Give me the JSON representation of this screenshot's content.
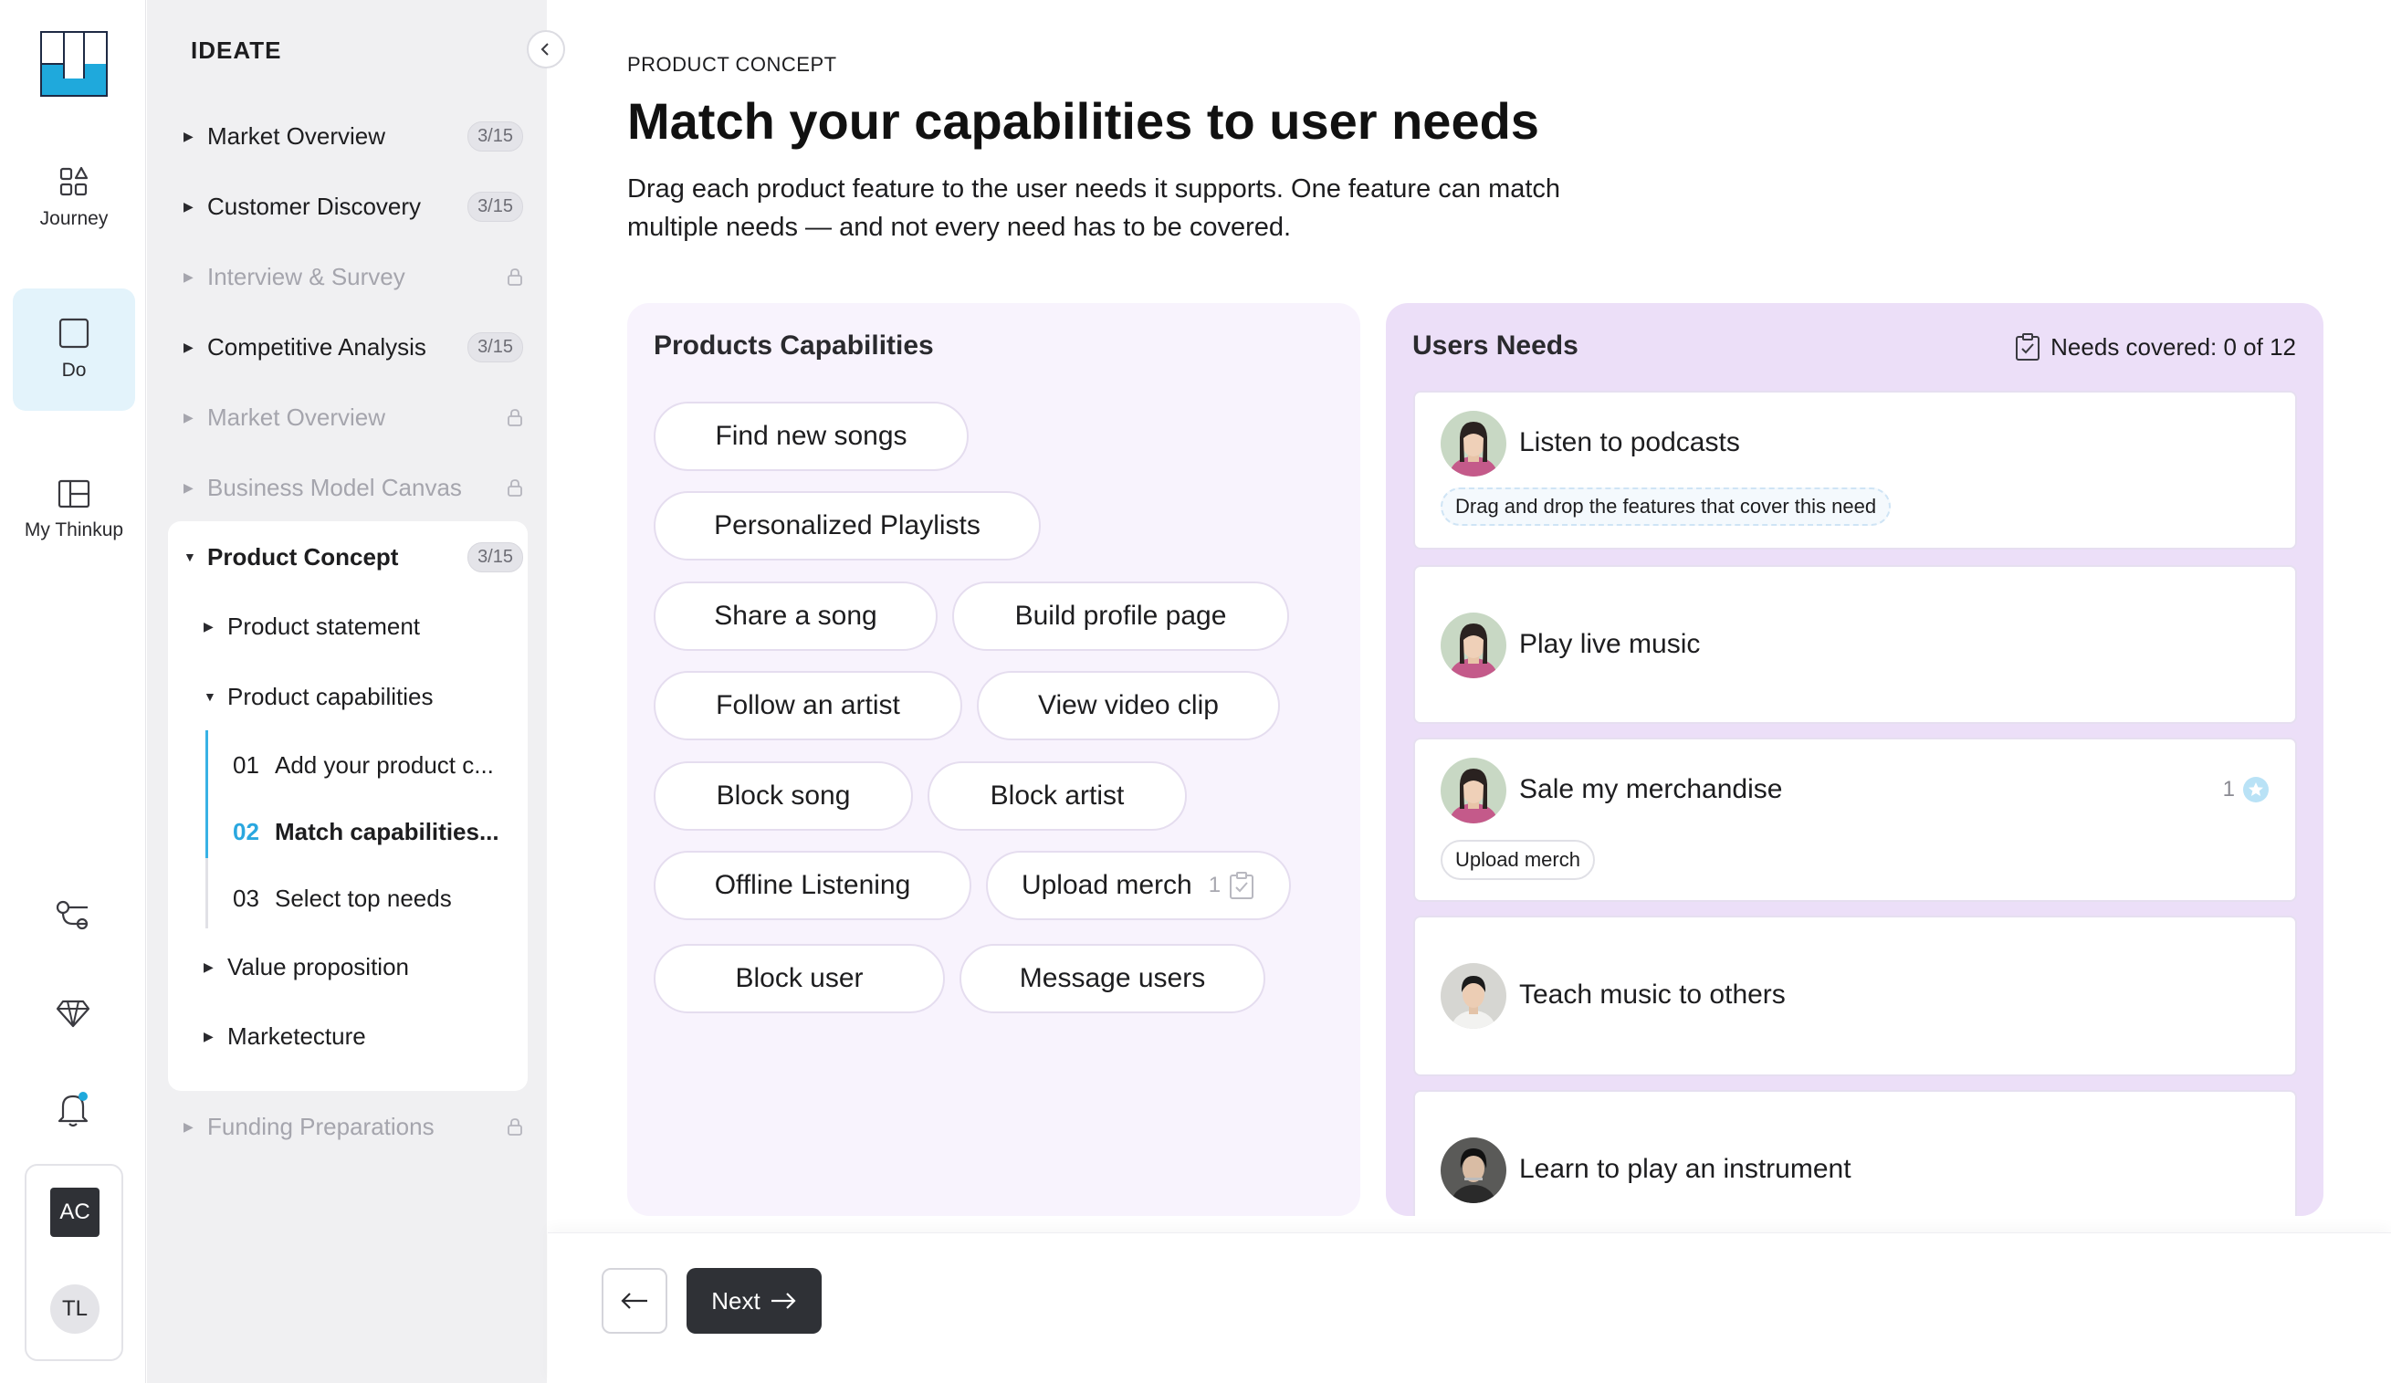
{
  "rail": {
    "items": [
      {
        "label": "Journey",
        "icon": "shapes-icon"
      },
      {
        "label": "Do",
        "icon": "square-icon"
      },
      {
        "label": "My Thinkup",
        "icon": "layout-icon"
      }
    ],
    "user_initials_1": "AC",
    "user_initials_2": "TL"
  },
  "sidebar": {
    "title": "IDEATE",
    "items": [
      {
        "label": "Market Overview",
        "count": "3/15",
        "state": "collapsed"
      },
      {
        "label": "Customer Discovery",
        "count": "3/15",
        "state": "collapsed"
      },
      {
        "label": "Interview & Survey",
        "state": "locked"
      },
      {
        "label": "Competitive Analysis",
        "count": "3/15",
        "state": "collapsed"
      },
      {
        "label": "Market Overview",
        "state": "locked"
      },
      {
        "label": "Business Model Canvas",
        "state": "locked"
      },
      {
        "label": "Product Concept",
        "count": "3/15",
        "state": "expanded"
      }
    ],
    "product_concept_children": [
      {
        "label": "Product statement"
      },
      {
        "label": "Product capabilities"
      },
      {
        "label": "Value proposition"
      },
      {
        "label": "Marketecture"
      }
    ],
    "steps": [
      {
        "num": "01",
        "label": "Add your product c..."
      },
      {
        "num": "02",
        "label": "Match capabilities..."
      },
      {
        "num": "03",
        "label": "Select top needs"
      }
    ],
    "after_items": [
      {
        "label": "Funding Preparations",
        "state": "locked"
      }
    ]
  },
  "main": {
    "eyebrow": "PRODUCT CONCEPT",
    "title": "Match your capabilities to user needs",
    "description": "Drag each product feature to the user needs it supports. One feature can match multiple needs — and not every need has to be covered."
  },
  "capabilities": {
    "title": "Products Capabilities",
    "chips": [
      {
        "label": "Find new songs"
      },
      {
        "label": "Personalized Playlists"
      },
      {
        "label": "Share a song"
      },
      {
        "label": "Build profile page"
      },
      {
        "label": "Follow an artist"
      },
      {
        "label": "View video clip"
      },
      {
        "label": "Block song"
      },
      {
        "label": "Block artist"
      },
      {
        "label": "Offline Listening"
      },
      {
        "label": "Upload merch",
        "count": "1"
      },
      {
        "label": "Block user"
      },
      {
        "label": "Message users"
      }
    ]
  },
  "needs": {
    "title": "Users Needs",
    "covered_label": "Needs covered: 0 of 12",
    "cards": [
      {
        "title": "Listen to podcasts",
        "hint": "Drag and drop the features that cover this need"
      },
      {
        "title": "Play live music"
      },
      {
        "title": "Sale my merchandise",
        "count": "1",
        "matched": [
          "Upload merch"
        ]
      },
      {
        "title": "Teach music to others"
      },
      {
        "title": "Learn to play an instrument"
      }
    ]
  },
  "footer": {
    "next_label": "Next"
  },
  "colors": {
    "accent": "#38b2e5",
    "cap_panel_bg": "#f8f3fd",
    "needs_panel_bg": "#ecdff8",
    "primary_button": "#2f3136"
  }
}
